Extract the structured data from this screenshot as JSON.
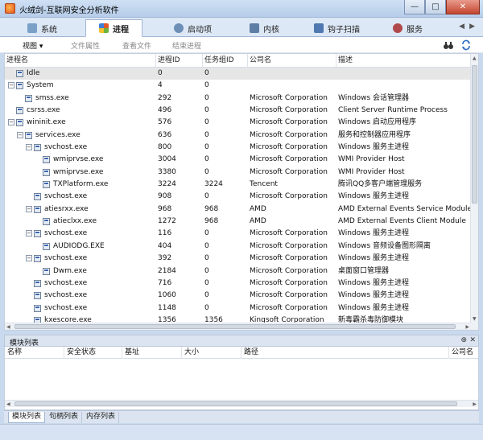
{
  "window": {
    "title": "火绒剑-互联网安全分析软件",
    "minimize": "—",
    "maximize": "□",
    "close": "✕"
  },
  "tabs": [
    {
      "label": "系统",
      "icon": "monitor-icon",
      "color": "#7aa0c8"
    },
    {
      "label": "进程",
      "icon": "windows-logo-icon",
      "color": "#e05a2a",
      "active": true
    },
    {
      "label": "启动项",
      "icon": "startup-icon",
      "color": "#6d8fb6"
    },
    {
      "label": "内核",
      "icon": "kernel-icon",
      "color": "#5f7ea6"
    },
    {
      "label": "钩子扫描",
      "icon": "hook-icon",
      "color": "#4f79b0"
    },
    {
      "label": "服务",
      "icon": "service-icon",
      "color": "#b04a4a"
    }
  ],
  "tab_arrows": "◀▶",
  "toolbar": {
    "view": "视图 ▾",
    "file_props": "文件属性",
    "view_file": "查看文件",
    "end_process": "结束进程",
    "binoculars_icon": "binoculars-icon",
    "refresh_icon": "refresh-icon"
  },
  "columns": {
    "name": "进程名",
    "pid": "进程ID",
    "tgid": "任务组ID",
    "company": "公司名",
    "desc": "描述"
  },
  "processes": [
    {
      "name": "Idle",
      "pid": "0",
      "tgid": "0",
      "company": "",
      "desc": "",
      "depth": 0,
      "toggle": "",
      "selected": true
    },
    {
      "name": "System",
      "pid": "4",
      "tgid": "0",
      "company": "",
      "desc": "",
      "depth": 0,
      "toggle": "−"
    },
    {
      "name": "smss.exe",
      "pid": "292",
      "tgid": "0",
      "company": "Microsoft Corporation",
      "desc": "Windows 会话管理器",
      "depth": 1,
      "toggle": ""
    },
    {
      "name": "csrss.exe",
      "pid": "496",
      "tgid": "0",
      "company": "Microsoft Corporation",
      "desc": "Client Server Runtime Process",
      "depth": 0,
      "toggle": ""
    },
    {
      "name": "wininit.exe",
      "pid": "576",
      "tgid": "0",
      "company": "Microsoft Corporation",
      "desc": "Windows 启动应用程序",
      "depth": 0,
      "toggle": "−"
    },
    {
      "name": "services.exe",
      "pid": "636",
      "tgid": "0",
      "company": "Microsoft Corporation",
      "desc": "服务和控制器应用程序",
      "depth": 1,
      "toggle": "−"
    },
    {
      "name": "svchost.exe",
      "pid": "800",
      "tgid": "0",
      "company": "Microsoft Corporation",
      "desc": "Windows 服务主进程",
      "depth": 2,
      "toggle": "−"
    },
    {
      "name": "wmiprvse.exe",
      "pid": "3004",
      "tgid": "0",
      "company": "Microsoft Corporation",
      "desc": "WMI Provider Host",
      "depth": 3,
      "toggle": ""
    },
    {
      "name": "wmiprvse.exe",
      "pid": "3380",
      "tgid": "0",
      "company": "Microsoft Corporation",
      "desc": "WMI Provider Host",
      "depth": 3,
      "toggle": ""
    },
    {
      "name": "TXPlatform.exe",
      "pid": "3224",
      "tgid": "3224",
      "company": "Tencent",
      "desc": "腾讯QQ多客户端管理服务",
      "depth": 3,
      "toggle": ""
    },
    {
      "name": "svchost.exe",
      "pid": "908",
      "tgid": "0",
      "company": "Microsoft Corporation",
      "desc": "Windows 服务主进程",
      "depth": 2,
      "toggle": ""
    },
    {
      "name": "atiesrxx.exe",
      "pid": "968",
      "tgid": "968",
      "company": "AMD",
      "desc": "AMD External Events Service Module",
      "depth": 2,
      "toggle": "−"
    },
    {
      "name": "atieclxx.exe",
      "pid": "1272",
      "tgid": "968",
      "company": "AMD",
      "desc": "AMD External Events Client Module",
      "depth": 3,
      "toggle": ""
    },
    {
      "name": "svchost.exe",
      "pid": "116",
      "tgid": "0",
      "company": "Microsoft Corporation",
      "desc": "Windows 服务主进程",
      "depth": 2,
      "toggle": "−"
    },
    {
      "name": "AUDIODG.EXE",
      "pid": "404",
      "tgid": "0",
      "company": "Microsoft Corporation",
      "desc": "Windows 音频设备图形隔离",
      "depth": 3,
      "toggle": ""
    },
    {
      "name": "svchost.exe",
      "pid": "392",
      "tgid": "0",
      "company": "Microsoft Corporation",
      "desc": "Windows 服务主进程",
      "depth": 2,
      "toggle": "−"
    },
    {
      "name": "Dwm.exe",
      "pid": "2184",
      "tgid": "0",
      "company": "Microsoft Corporation",
      "desc": "桌面窗口管理器",
      "depth": 3,
      "toggle": ""
    },
    {
      "name": "svchost.exe",
      "pid": "716",
      "tgid": "0",
      "company": "Microsoft Corporation",
      "desc": "Windows 服务主进程",
      "depth": 2,
      "toggle": ""
    },
    {
      "name": "svchost.exe",
      "pid": "1060",
      "tgid": "0",
      "company": "Microsoft Corporation",
      "desc": "Windows 服务主进程",
      "depth": 2,
      "toggle": ""
    },
    {
      "name": "svchost.exe",
      "pid": "1148",
      "tgid": "0",
      "company": "Microsoft Corporation",
      "desc": "Windows 服务主进程",
      "depth": 2,
      "toggle": ""
    },
    {
      "name": "kxescore.exe",
      "pid": "1356",
      "tgid": "1356",
      "company": "Kingsoft Corporation",
      "desc": "新毒霸杀毒防御模块",
      "depth": 2,
      "toggle": ""
    }
  ],
  "modules_panel": {
    "title": "模块列表",
    "pin": "⊕",
    "close": "✕",
    "columns": [
      "名称",
      "安全状态",
      "基址",
      "大小",
      "路径",
      "公司名"
    ]
  },
  "bottom_tabs": [
    "模块列表",
    "句柄列表",
    "内存列表"
  ],
  "scroll_glyphs": {
    "up": "▲",
    "down": "▼",
    "left": "◀",
    "right": "▶"
  }
}
